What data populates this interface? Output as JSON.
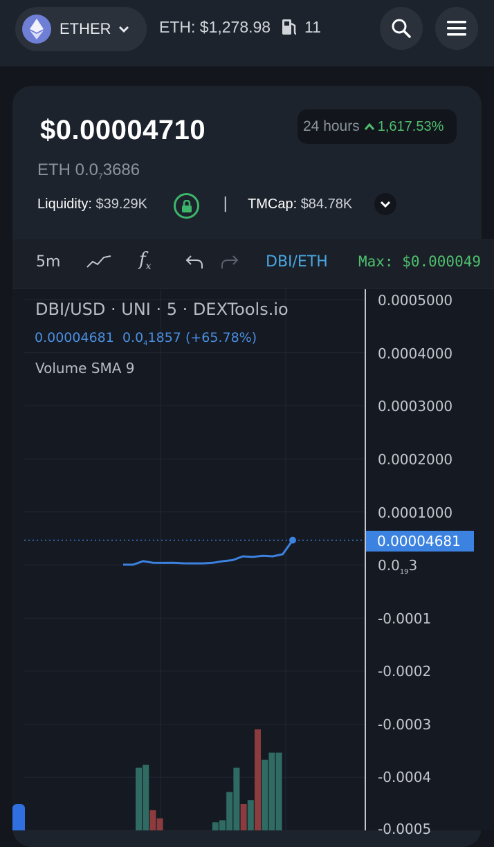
{
  "header": {
    "network_label": "ETHER",
    "eth_price": "ETH: $1,278.98",
    "gas_value": "11"
  },
  "token": {
    "price_usd": "$0.00004710",
    "price_eth_prefix": "ETH 0.0",
    "price_eth_sub": "7",
    "price_eth_suffix": "3686",
    "change_period": "24 hours",
    "change_value": "1,617.53%",
    "liquidity_label": "Liquidity:",
    "liquidity_value": "$39.29K",
    "separator": "|",
    "tmcap_label": "TMCap:",
    "tmcap_value": "$84.78K"
  },
  "chart_toolbar": {
    "interval": "5m",
    "pair": "DBI/ETH",
    "max_label": "Max: $0.000049"
  },
  "chart_legend": {
    "title": "DBI/USD · UNI · 5 · DEXTools.io",
    "value_current": "0.00004681",
    "value_change_prefix": "0.0",
    "value_change_sub": "4",
    "value_change_suffix": "1857",
    "value_change_pct": "(+65.78%)",
    "volume_label": "Volume SMA 9"
  },
  "y_axis": {
    "t1": "0.0005000",
    "t2": "0.0004000",
    "t3": "0.0003000",
    "t4": "0.0002000",
    "t5": "0.0001000",
    "t6_prefix": "0.0",
    "t6_sub": "19",
    "t6_suffix": "3",
    "t7": "-0.0001",
    "t8": "-0.0002",
    "t9": "-0.0003",
    "t10": "-0.0004",
    "t11": "-0.0005",
    "current_price": "0.00004681"
  },
  "chart_data": {
    "type": "line",
    "title": "DBI/USD · UNI · 5 · DEXTools.io",
    "ylim": [
      -0.0005,
      0.0005
    ],
    "series": [
      {
        "values": [
          7e-07,
          7e-07,
          7.3e-06,
          4.3e-06,
          4.1e-06,
          4.3e-06,
          3.3e-06,
          3.1e-06,
          3.1e-06,
          4.2e-06,
          7.2e-06,
          9.3e-06,
          1.63e-05,
          1.53e-05,
          1.73e-05,
          1.63e-05,
          2.04e-05,
          4.68e-05
        ]
      }
    ],
    "volume_bars": [
      {
        "value": 0.62,
        "dir": "up"
      },
      {
        "value": 0.65,
        "dir": "up"
      },
      {
        "value": 0.2,
        "dir": "down"
      },
      {
        "value": 0.12,
        "dir": "down"
      },
      {
        "value": 0.08,
        "dir": "up"
      },
      {
        "value": 0.1,
        "dir": "up"
      },
      {
        "value": 0.38,
        "dir": "up"
      },
      {
        "value": 0.62,
        "dir": "up"
      },
      {
        "value": 0.26,
        "dir": "down"
      },
      {
        "value": 0.3,
        "dir": "up"
      },
      {
        "value": 1.0,
        "dir": "down"
      },
      {
        "value": 0.7,
        "dir": "up"
      },
      {
        "value": 0.77,
        "dir": "up"
      },
      {
        "value": 0.77,
        "dir": "up"
      }
    ],
    "colors": {
      "line": "#3c82e0",
      "vol_up": "#2f6b62",
      "vol_down": "#8c3b3e"
    }
  }
}
